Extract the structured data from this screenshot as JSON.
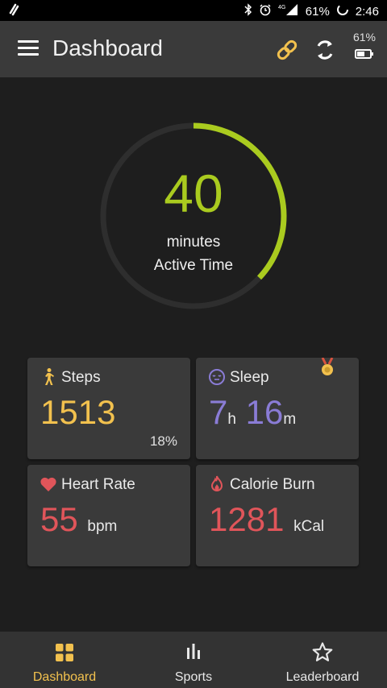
{
  "status_bar": {
    "battery_percent": "61%",
    "time": "2:46",
    "network": "4G"
  },
  "app_bar": {
    "title": "Dashboard",
    "battery_percent": "61%"
  },
  "activity_ring": {
    "value": "40",
    "unit": "minutes",
    "label": "Active Time",
    "progress": 0.37,
    "color": "#aacb1f"
  },
  "cards": {
    "steps": {
      "title": "Steps",
      "value": "1513",
      "percent": "18%",
      "color": "#f2c14e"
    },
    "sleep": {
      "title": "Sleep",
      "hours": "7",
      "hours_unit": "h",
      "minutes": "16",
      "minutes_unit": "m",
      "color": "#8a7cd6"
    },
    "heart_rate": {
      "title": "Heart Rate",
      "value": "55",
      "unit": "bpm",
      "color": "#e0555a"
    },
    "calorie_burn": {
      "title": "Calorie Burn",
      "value": "1281",
      "unit": "kCal",
      "color": "#e0555a"
    }
  },
  "bottom_nav": {
    "items": [
      {
        "label": "Dashboard",
        "active": true
      },
      {
        "label": "Sports",
        "active": false
      },
      {
        "label": "Leaderboard",
        "active": false
      }
    ],
    "active_color": "#f2c14e"
  }
}
